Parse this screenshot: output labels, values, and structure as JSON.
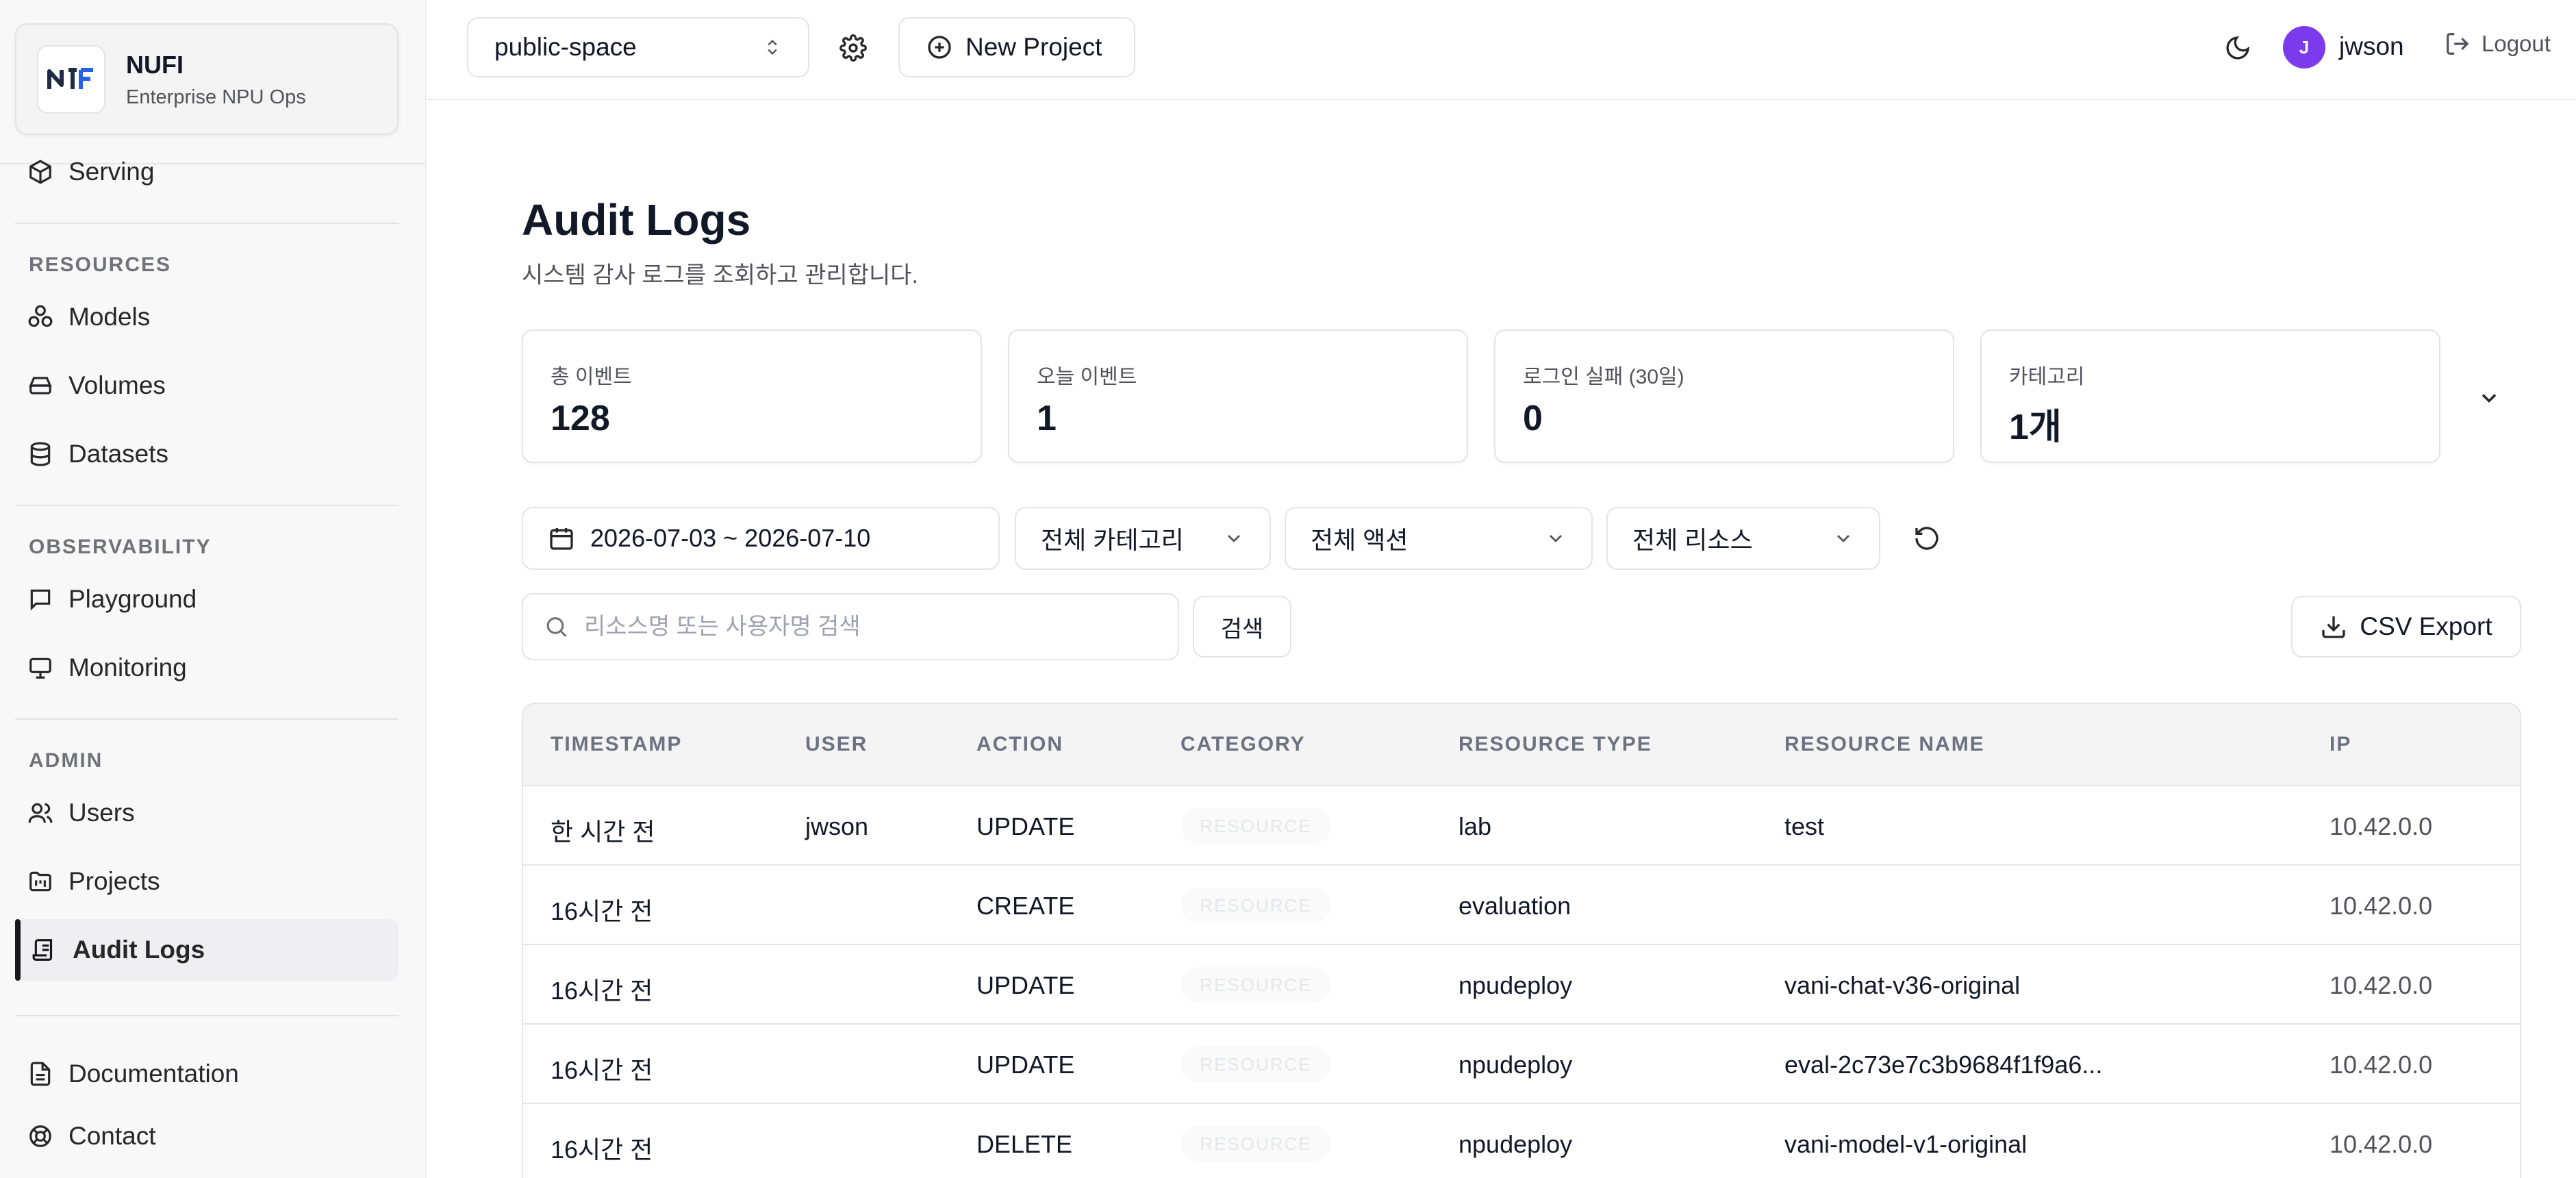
{
  "brand": {
    "name": "NUFI",
    "subtitle": "Enterprise NPU Ops"
  },
  "sidebar": {
    "serving": "Serving",
    "sections": {
      "resources": "RESOURCES",
      "observability": "OBSERVABILITY",
      "admin": "ADMIN"
    },
    "resources": [
      "Models",
      "Volumes",
      "Datasets"
    ],
    "observability": [
      "Playground",
      "Monitoring"
    ],
    "admin": [
      "Users",
      "Projects",
      "Audit Logs"
    ],
    "footer": [
      "Documentation",
      "Contact"
    ]
  },
  "topbar": {
    "project": "public-space",
    "new_project": "New Project",
    "user_initial": "J",
    "username": "jwson",
    "logout": "Logout"
  },
  "page": {
    "title": "Audit Logs",
    "subtitle": "시스템 감사 로그를 조회하고 관리합니다."
  },
  "stats": [
    {
      "label": "총 이벤트",
      "value": "128"
    },
    {
      "label": "오늘 이벤트",
      "value": "1"
    },
    {
      "label": "로그인 실패 (30일)",
      "value": "0"
    },
    {
      "label": "카테고리",
      "value": "1개"
    }
  ],
  "filters": {
    "date_range": "2026-07-03 ~ 2026-07-10",
    "category": "전체 카테고리",
    "action": "전체 액션",
    "resource": "전체 리소스",
    "search_placeholder": "리소스명 또는 사용자명 검색",
    "search_button": "검색",
    "csv_export": "CSV Export"
  },
  "table": {
    "columns": [
      "TIMESTAMP",
      "USER",
      "ACTION",
      "CATEGORY",
      "RESOURCE TYPE",
      "RESOURCE NAME",
      "IP"
    ],
    "rows": [
      {
        "timestamp": "한 시간 전",
        "user": "jwson",
        "action": "UPDATE",
        "category": "RESOURCE",
        "resource_type": "lab",
        "resource_name": "test",
        "ip": "10.42.0.0"
      },
      {
        "timestamp": "16시간 전",
        "user": "",
        "action": "CREATE",
        "category": "RESOURCE",
        "resource_type": "evaluation",
        "resource_name": "",
        "ip": "10.42.0.0"
      },
      {
        "timestamp": "16시간 전",
        "user": "",
        "action": "UPDATE",
        "category": "RESOURCE",
        "resource_type": "npudeploy",
        "resource_name": "vani-chat-v36-original",
        "ip": "10.42.0.0"
      },
      {
        "timestamp": "16시간 전",
        "user": "",
        "action": "UPDATE",
        "category": "RESOURCE",
        "resource_type": "npudeploy",
        "resource_name": "eval-2c73e7c3b9684f1f9a6...",
        "ip": "10.42.0.0"
      },
      {
        "timestamp": "16시간 전",
        "user": "",
        "action": "DELETE",
        "category": "RESOURCE",
        "resource_type": "npudeploy",
        "resource_name": "vani-model-v1-original",
        "ip": "10.42.0.0"
      }
    ]
  },
  "colors": {
    "accent": "#7c3aed",
    "active_bar": "#18181b",
    "border": "#e4e4e7"
  }
}
